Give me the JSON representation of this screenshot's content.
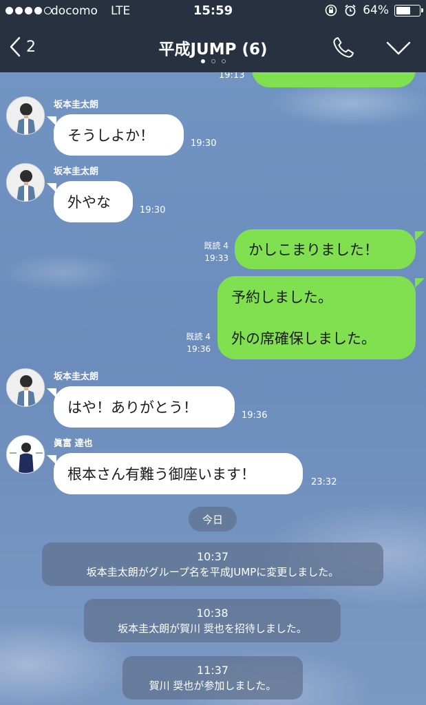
{
  "status_bar": {
    "carrier": "docomo",
    "network": "LTE",
    "time": "15:59",
    "battery": "64%",
    "battery_level": 0.64,
    "signal_bars": 4,
    "icons": [
      "rotation-lock-icon",
      "alarm-icon"
    ]
  },
  "header": {
    "back_count": "2",
    "title": "平成JUMP (6)",
    "page_indicator": {
      "count": 3,
      "active": 0
    },
    "icons": [
      "back-chevron-icon",
      "phone-icon",
      "chevron-down-icon"
    ]
  },
  "colors": {
    "header_bg": "#27313f",
    "outgoing_bubble": "#80e04f",
    "incoming_bubble": "#ffffff",
    "system_pill": "#60738f"
  },
  "chat": {
    "partial_message_time": "19:13",
    "messages": [
      {
        "sender": "坂本圭太朗",
        "text": "そうしよか！",
        "time": "19:30"
      },
      {
        "sender": "坂本圭太朗",
        "text": "外やな",
        "time": "19:30"
      },
      {
        "read": "既読 4",
        "text": "かしこまりました！",
        "time": "19:33"
      },
      {
        "read": "既読 4",
        "lines": [
          "予約しました。",
          "外の席確保しました。"
        ],
        "time": "19:36"
      },
      {
        "sender": "坂本圭太朗",
        "text": "はや！ありがとう！",
        "time": "19:36"
      },
      {
        "sender": "眞富 達也",
        "text": "根本さん有難う御座います！",
        "time": "23:32"
      }
    ],
    "date_divider": "今日",
    "system_messages": [
      {
        "time": "10:37",
        "text": "坂本圭太朗がグループ名を平成JUMPに変更しました。"
      },
      {
        "time": "10:38",
        "text": "坂本圭太朗が賀川 奨也を招待しました。"
      },
      {
        "time": "11:37",
        "text": "賀川 奨也が参加しました。"
      }
    ]
  }
}
